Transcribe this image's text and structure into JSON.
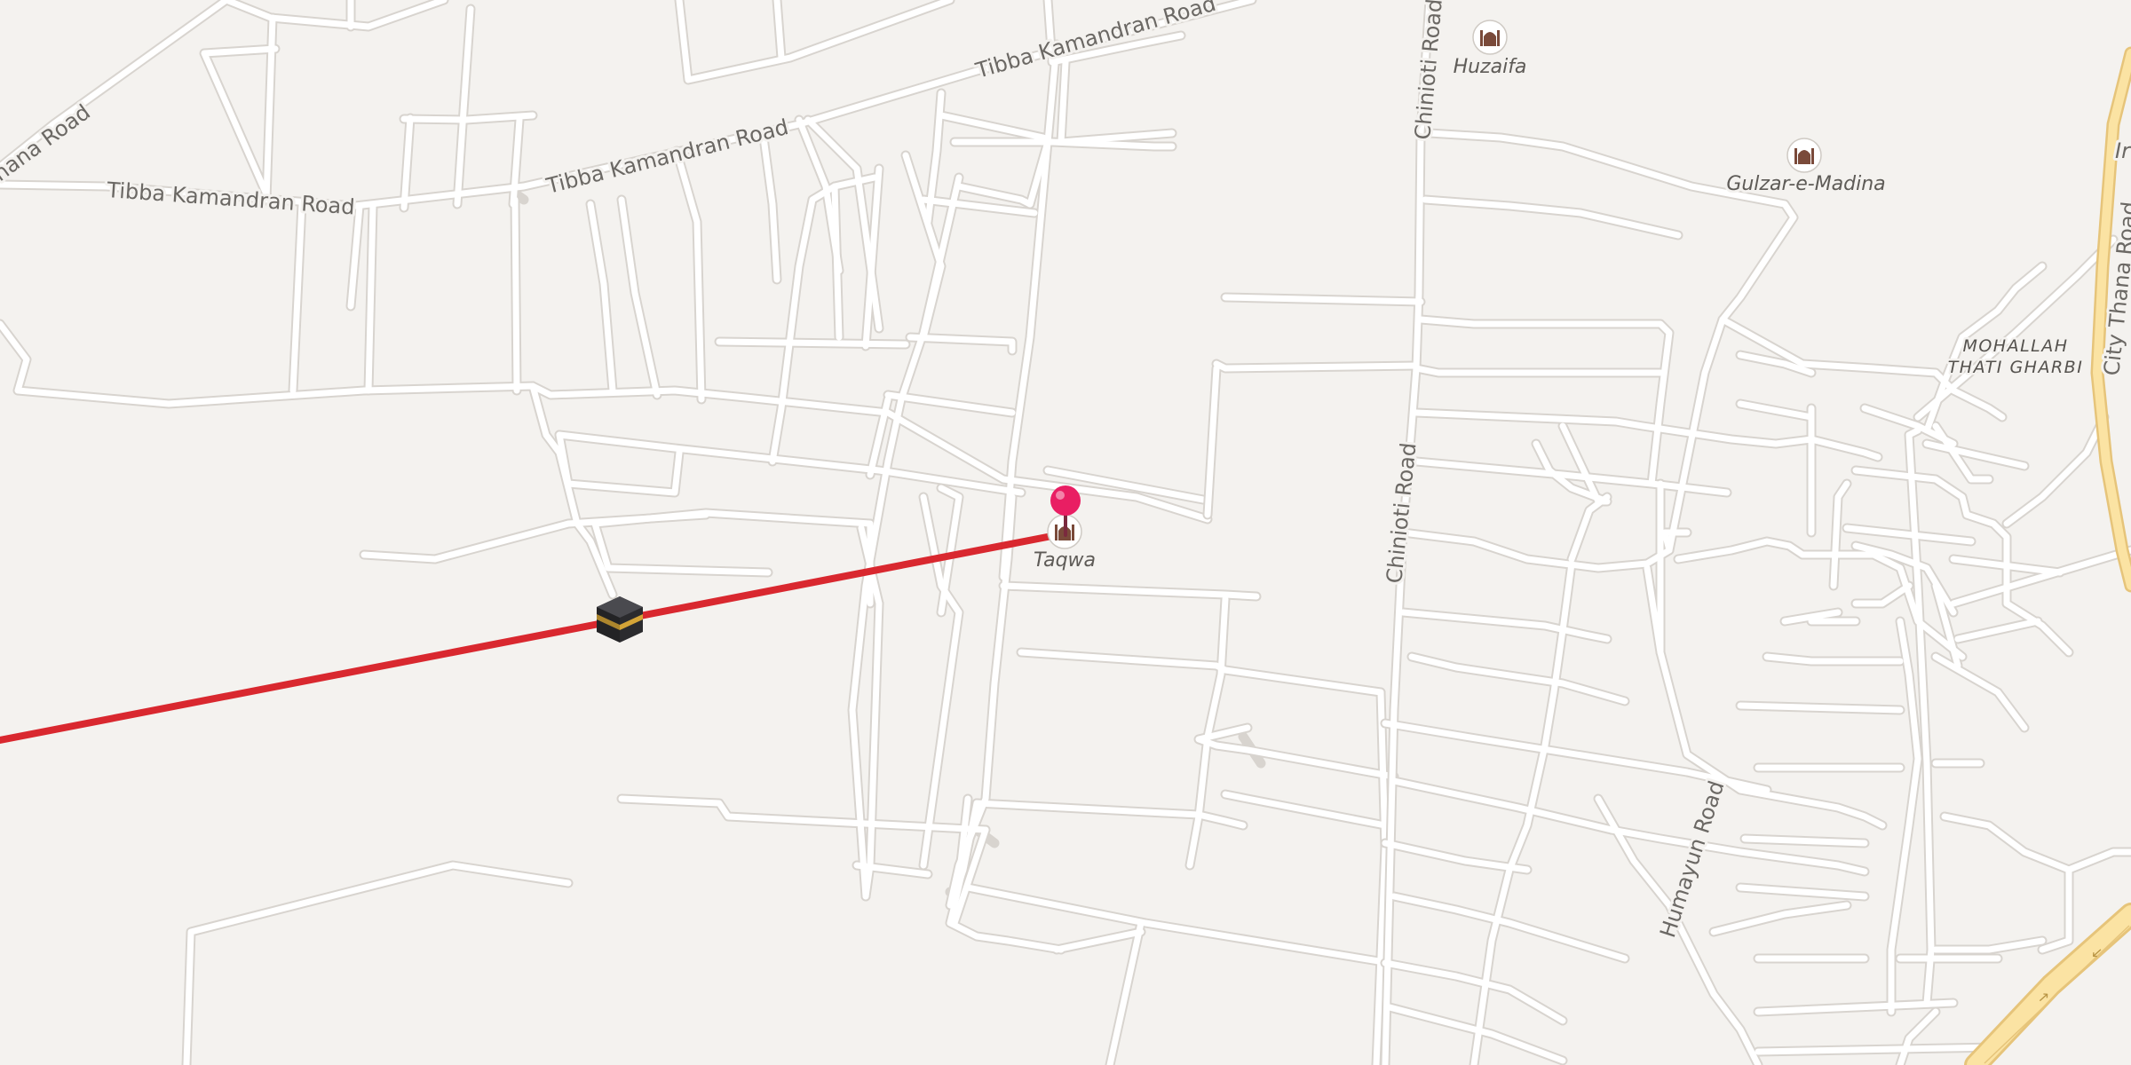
{
  "map": {
    "colors": {
      "background": "#f4f2ef",
      "road": "#ffffff",
      "major_road": "#fbe3a3",
      "qibla_line": "#d9282f",
      "pin": "#e91e63"
    },
    "road_labels": {
      "thana_road_nw": "hana Road",
      "tibba_kamandran_1": "Tibba Kamandran Road",
      "tibba_kamandran_2": "Tibba Kamandran Road",
      "tibba_kamandran_3": "Tibba Kamandran Road",
      "chinioti_road_north": "Chinioti Road",
      "chinioti_road_south": "Chinioti Road",
      "humayun_road": "Humayun Road",
      "city_thana_road": "City Thana Road",
      "edge_label": "Ir"
    },
    "area_labels": {
      "mohallah_line1": "MOHALLAH",
      "mohallah_line2": "THATI GHARBI"
    },
    "pois": {
      "huzaifa": "Huzaifa",
      "gulzar_e_madina": "Gulzar-e-Madina",
      "taqwa": "Taqwa"
    },
    "icons": {
      "mosque": "mosque-icon",
      "kaaba": "kaaba-icon",
      "pin": "location-pin-icon"
    }
  }
}
